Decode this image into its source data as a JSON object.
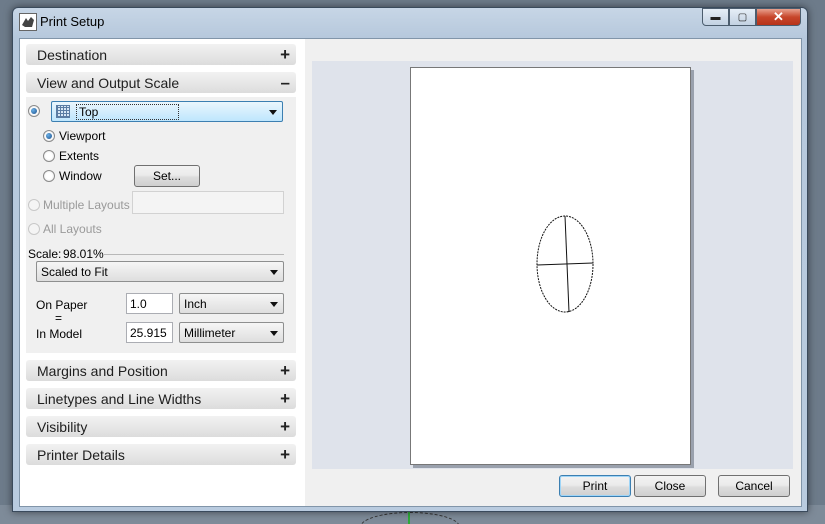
{
  "window": {
    "title": "Print Setup"
  },
  "titlebar_buttons": {
    "minimize": "▬",
    "maximize": "▢",
    "close": "✕"
  },
  "sections": {
    "destination": {
      "label": "Destination",
      "toggle": "+"
    },
    "view_output_scale": {
      "label": "View and Output Scale",
      "toggle": "–"
    },
    "margins_position": {
      "label": "Margins and Position",
      "toggle": "+"
    },
    "linetypes": {
      "label": "Linetypes and Line Widths",
      "toggle": "+"
    },
    "visibility": {
      "label": "Visibility",
      "toggle": "+"
    },
    "printer_details": {
      "label": "Printer Details",
      "toggle": "+"
    }
  },
  "view_scale": {
    "view_select": "Top",
    "area_options": {
      "viewport": "Viewport",
      "extents": "Extents",
      "window": "Window"
    },
    "set_button": "Set...",
    "multiple_layouts": "Multiple Layouts",
    "all_layouts": "All Layouts",
    "scale_label": "Scale:",
    "scale_value": "98.01%",
    "scale_mode": "Scaled to Fit",
    "on_paper_label": "On Paper",
    "equals": "=",
    "in_model_label": "In Model",
    "on_paper_value": "1.0",
    "on_paper_unit": "Inch",
    "in_model_value": "25.915",
    "in_model_unit": "Millimeter"
  },
  "buttons": {
    "print": "Print",
    "close": "Close",
    "cancel": "Cancel"
  },
  "colors": {
    "accent": "#3c7fb1",
    "preview_bg": "#dfe3eb",
    "close_red": "#c7462b"
  }
}
